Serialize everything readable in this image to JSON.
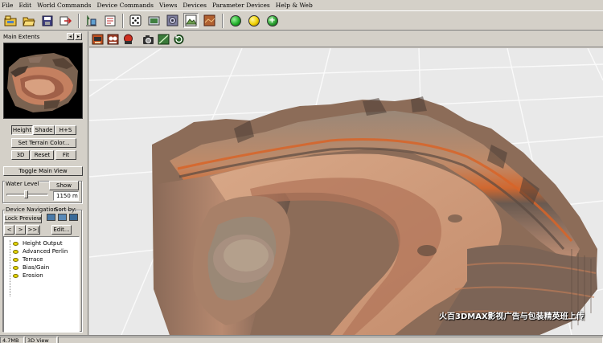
{
  "menu": [
    "File",
    "Edit",
    "World Commands",
    "Device Commands",
    "Views",
    "Devices",
    "Parameter Devices",
    "Help & Web"
  ],
  "toolbar": {
    "icons": [
      "new-world-icon",
      "open-icon",
      "save-icon",
      "export-icon",
      "device-icon",
      "layout-icon",
      "random-icon",
      "render-icon",
      "settings-icon",
      "terrain-view-icon",
      "texture-view-icon"
    ],
    "status_colors": [
      "#22b02a",
      "#f0d000",
      "#2aa030"
    ]
  },
  "left_panel": {
    "title": "Main Extents",
    "prev_arrow": "◂",
    "next_arrow": "▸",
    "height_label": "Height",
    "shade_label": "Shade",
    "hs_label": "H+S",
    "set_terrain_color_label": "Set Terrain Color...",
    "btn_3d_label": "3D",
    "reset_label": "Reset",
    "fit_label": "Fit",
    "toggle_main_view_label": "Toggle Main View",
    "water_level_label": "Water Level",
    "show_label": "Show",
    "water_level_value": "1150 m",
    "device_navigation_label": "Device Navigation",
    "sort_by_label": "Sort by:",
    "lock_preview_label": "Lock Preview",
    "nav_back": "<",
    "nav_forward": ">",
    "nav_last": ">>|",
    "edit_label": "Edit...",
    "devices": [
      "Height Output",
      "Advanced Perlin",
      "Terrace",
      "Bias/Gain",
      "Erosion"
    ]
  },
  "view_toolbar": {
    "icons": [
      "cam-icon",
      "walk-icon",
      "dbl-icon",
      "camera-icon",
      "slope-icon",
      "refresh-icon"
    ]
  },
  "viewport": {
    "watermark": "火百3DMAX影视广告与包装精英班上传"
  },
  "statusbar": {
    "left": "4.7MB",
    "view": "3D View"
  }
}
